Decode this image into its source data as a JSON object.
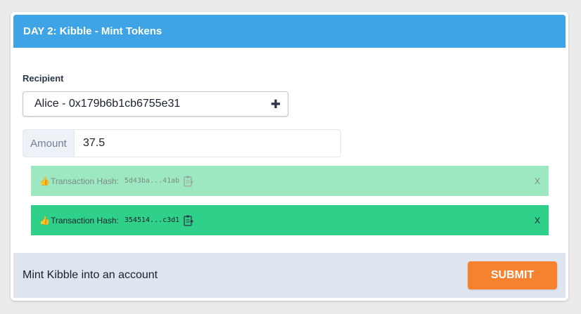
{
  "header": {
    "title": "DAY 2: Kibble - Mint Tokens"
  },
  "recipient": {
    "label": "Recipient",
    "selected": "Alice - 0x179b6b1cb6755e31",
    "add_icon": "plus-icon"
  },
  "amount": {
    "addon": "Amount",
    "value": "37.5"
  },
  "transactions": [
    {
      "icon": "thumbs-up",
      "label": "Transaction Hash:",
      "hash": "5d43ba...41ab",
      "close": "X",
      "status": "pending",
      "bg": "#9ee8c1"
    },
    {
      "icon": "thumbs-up",
      "label": "Transaction Hash:",
      "hash": "354514...c3d1",
      "close": "X",
      "status": "confirmed",
      "bg": "#2fd089"
    }
  ],
  "footer": {
    "text": "Mint Kibble into an account",
    "submit_label": "SUBMIT"
  },
  "colors": {
    "header": "#3ea4e6",
    "submit": "#f6812f",
    "footer": "#dfe5ee"
  }
}
